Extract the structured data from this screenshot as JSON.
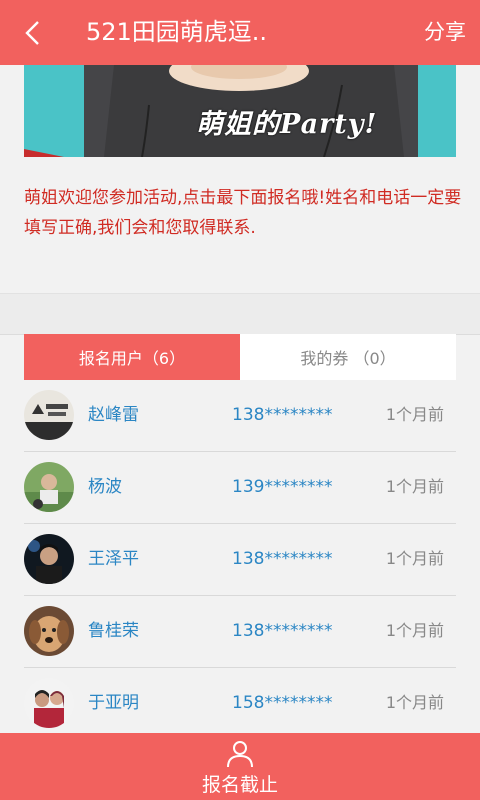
{
  "header": {
    "back_icon": "chevron-left-icon",
    "title": "521田园萌虎逗..",
    "share_label": "分享"
  },
  "banner": {
    "text": "萌姐的Party!"
  },
  "notice": {
    "text": "萌姐欢迎您参加活动,点击最下面报名哦!姓名和电话一定要填写正确,我们会和您取得联系."
  },
  "tabs": [
    {
      "label": "报名用户（6）",
      "active": true
    },
    {
      "label": "我的券 （0）",
      "active": false
    }
  ],
  "registrants": [
    {
      "name": "赵峰雷",
      "phone": "138********",
      "time": "1个月前"
    },
    {
      "name": "杨波",
      "phone": "139********",
      "time": "1个月前"
    },
    {
      "name": "王泽平",
      "phone": "138********",
      "time": "1个月前"
    },
    {
      "name": "鲁桂荣",
      "phone": "138********",
      "time": "1个月前"
    },
    {
      "name": "于亚明",
      "phone": "158********",
      "time": "1个月前"
    }
  ],
  "footer": {
    "icon": "user-icon",
    "label": "报名截止"
  },
  "colors": {
    "accent": "#f2615e",
    "notice_text": "#d02b23",
    "link_blue": "#2b86c4"
  }
}
